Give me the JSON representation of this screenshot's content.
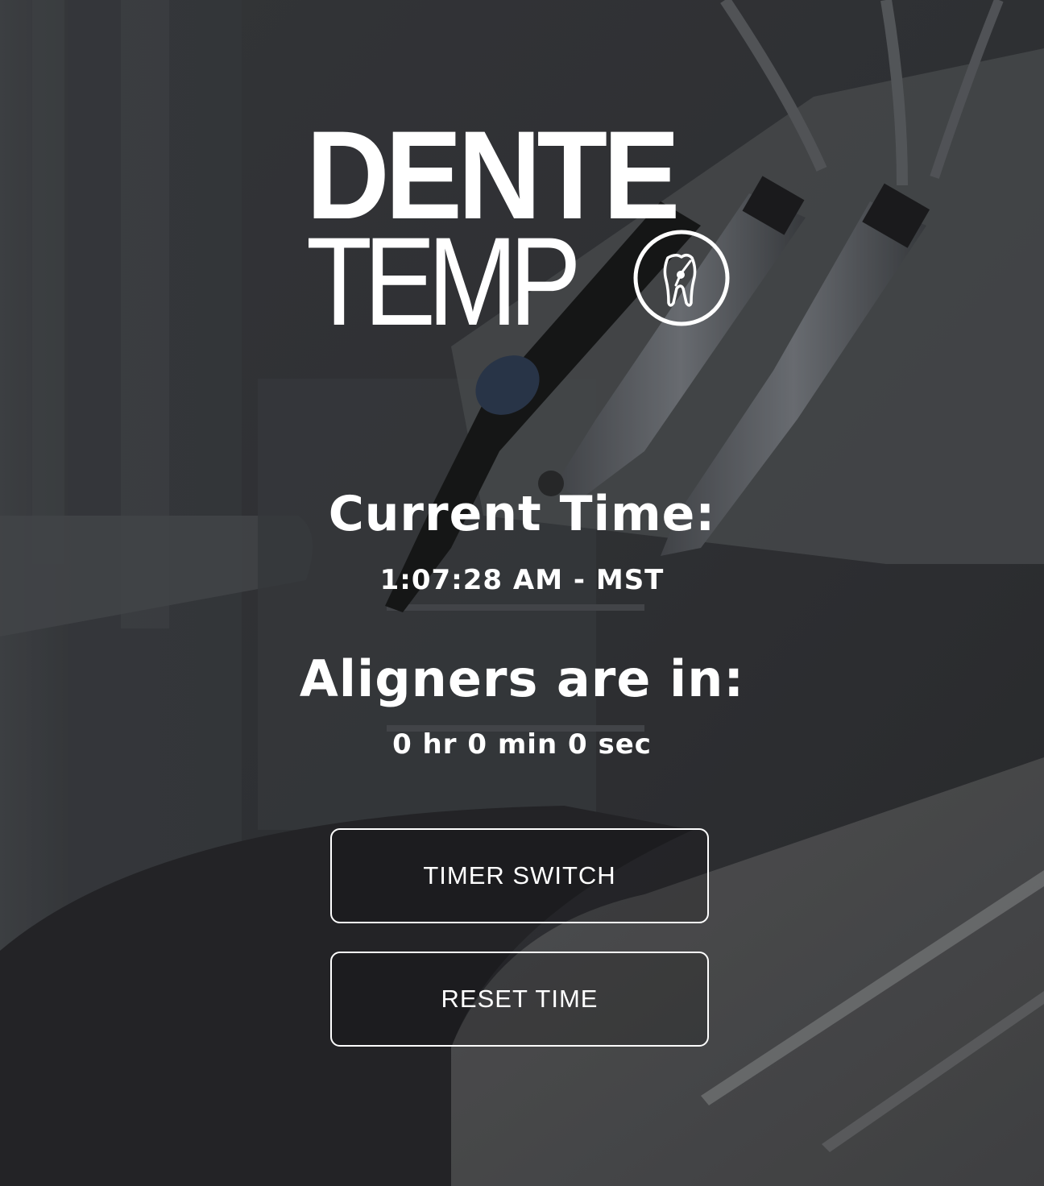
{
  "logo": {
    "line1": "DENTE",
    "line2": "TEMP",
    "emblem_icon": "tooth-icon"
  },
  "clock": {
    "heading": "Current Time:",
    "value": "1:07:28 AM - MST"
  },
  "aligners": {
    "heading": "Aligners are in:",
    "value": "0 hr 0 min 0 sec"
  },
  "buttons": {
    "timer_switch": "TIMER SWITCH",
    "reset_time": "RESET TIME"
  },
  "colors": {
    "text": "#ffffff",
    "background": "#2f3032"
  }
}
